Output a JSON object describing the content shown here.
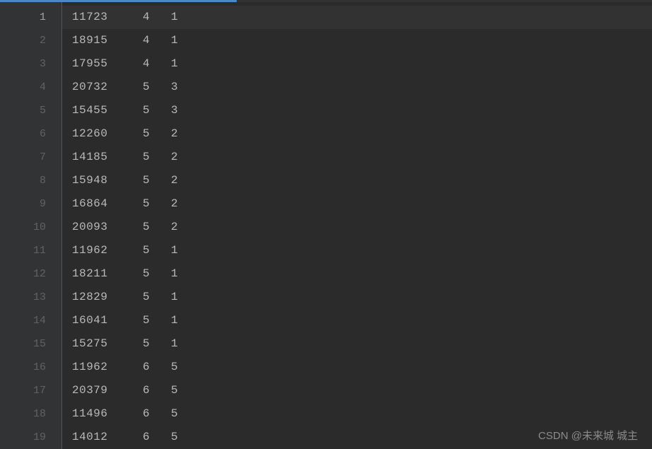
{
  "editor": {
    "current_line": 1,
    "rows": [
      {
        "line": "1",
        "c1": "11723",
        "c2": "4",
        "c3": "1"
      },
      {
        "line": "2",
        "c1": "18915",
        "c2": "4",
        "c3": "1"
      },
      {
        "line": "3",
        "c1": "17955",
        "c2": "4",
        "c3": "1"
      },
      {
        "line": "4",
        "c1": "20732",
        "c2": "5",
        "c3": "3"
      },
      {
        "line": "5",
        "c1": "15455",
        "c2": "5",
        "c3": "3"
      },
      {
        "line": "6",
        "c1": "12260",
        "c2": "5",
        "c3": "2"
      },
      {
        "line": "7",
        "c1": "14185",
        "c2": "5",
        "c3": "2"
      },
      {
        "line": "8",
        "c1": "15948",
        "c2": "5",
        "c3": "2"
      },
      {
        "line": "9",
        "c1": "16864",
        "c2": "5",
        "c3": "2"
      },
      {
        "line": "10",
        "c1": "20093",
        "c2": "5",
        "c3": "2"
      },
      {
        "line": "11",
        "c1": "11962",
        "c2": "5",
        "c3": "1"
      },
      {
        "line": "12",
        "c1": "18211",
        "c2": "5",
        "c3": "1"
      },
      {
        "line": "13",
        "c1": "12829",
        "c2": "5",
        "c3": "1"
      },
      {
        "line": "14",
        "c1": "16041",
        "c2": "5",
        "c3": "1"
      },
      {
        "line": "15",
        "c1": "15275",
        "c2": "5",
        "c3": "1"
      },
      {
        "line": "16",
        "c1": "11962",
        "c2": "6",
        "c3": "5"
      },
      {
        "line": "17",
        "c1": "20379",
        "c2": "6",
        "c3": "5"
      },
      {
        "line": "18",
        "c1": "11496",
        "c2": "6",
        "c3": "5"
      },
      {
        "line": "19",
        "c1": "14012",
        "c2": "6",
        "c3": "5"
      }
    ]
  },
  "watermark": "CSDN @未来城   城主"
}
